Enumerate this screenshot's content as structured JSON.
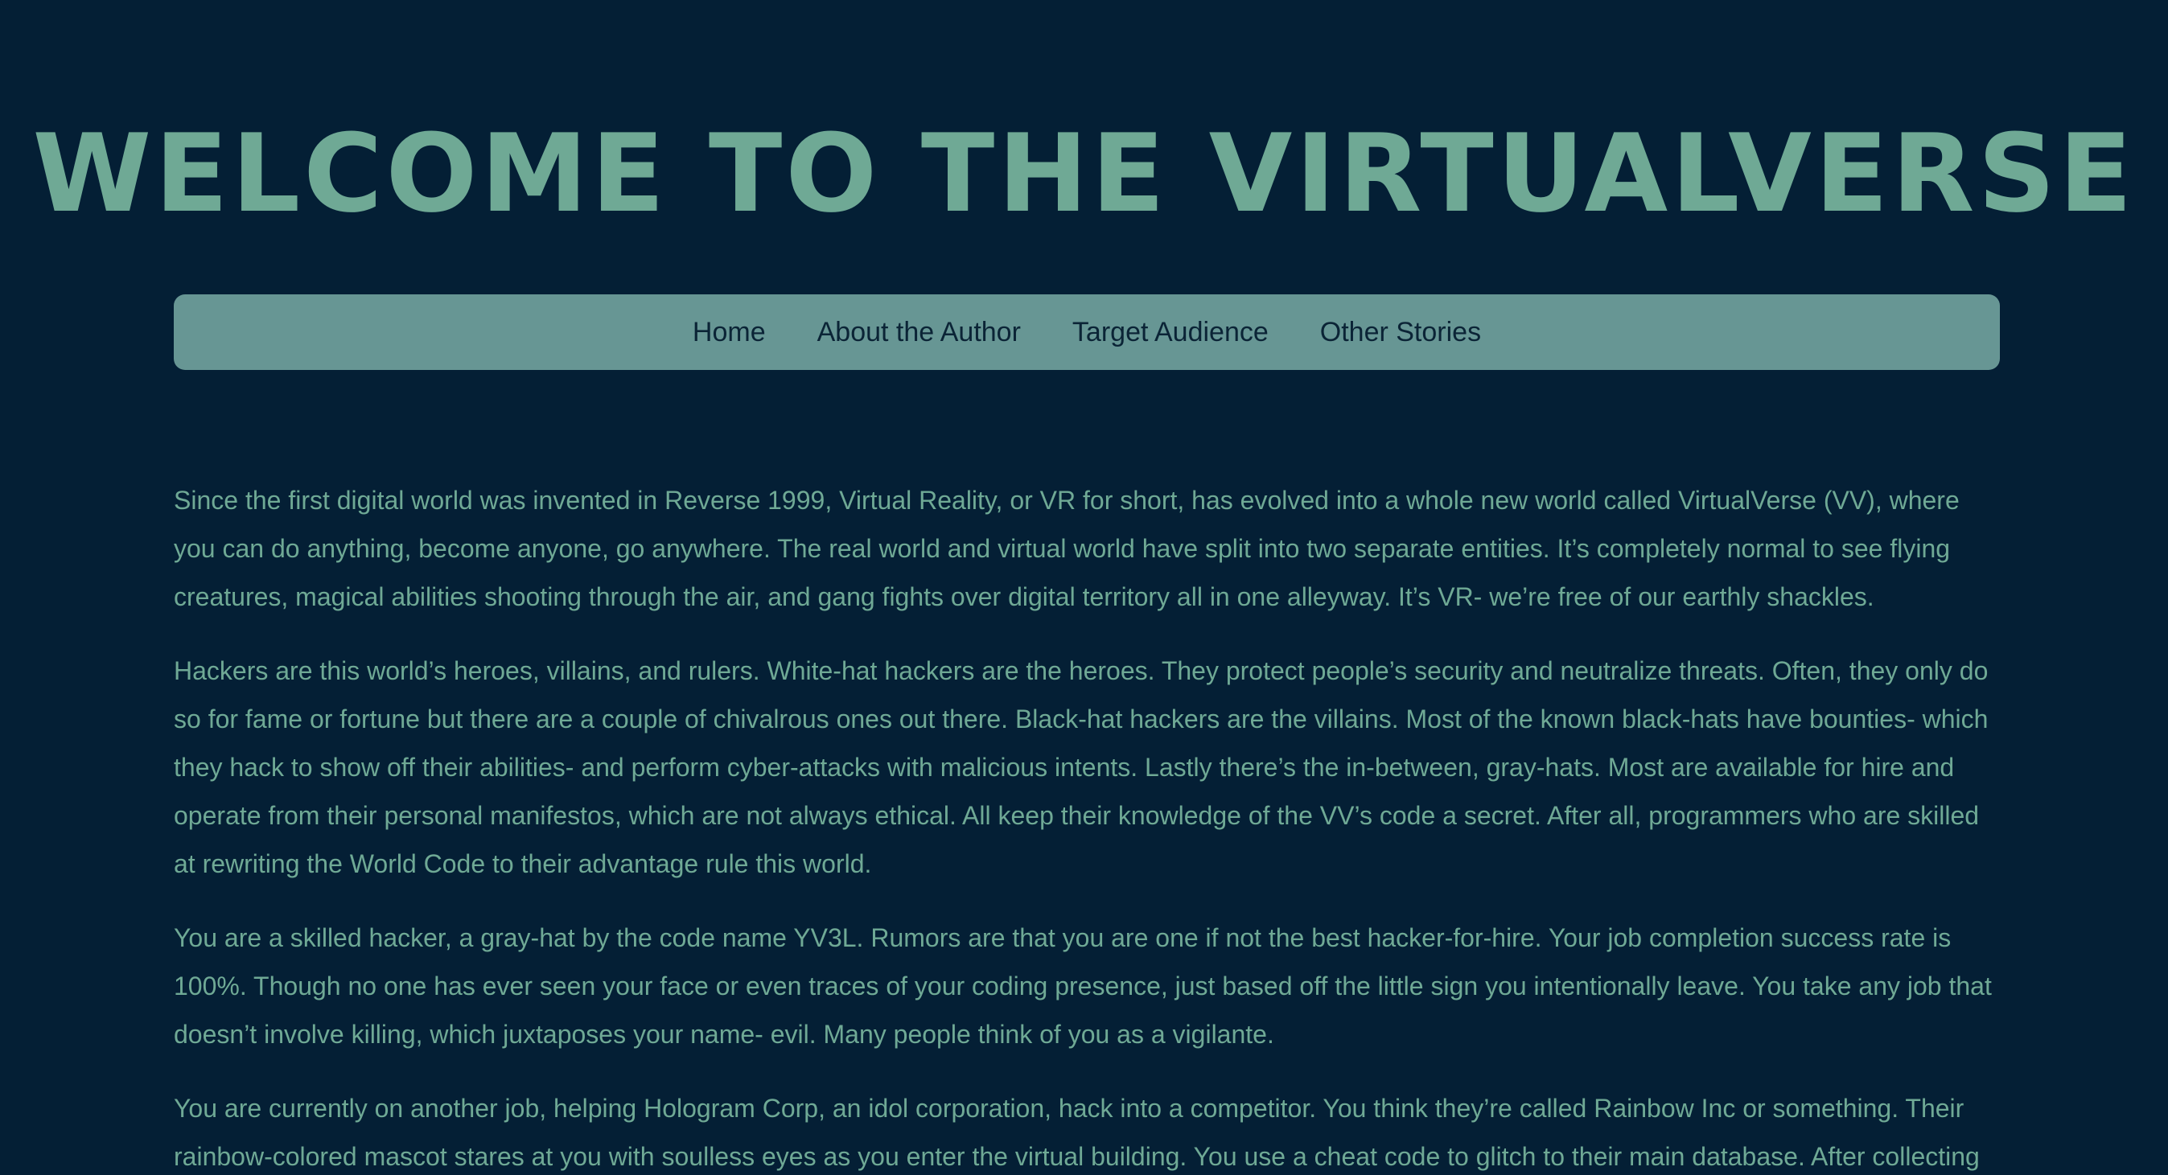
{
  "header": {
    "title": "WELCOME TO THE VIRTUALVERSE"
  },
  "nav": {
    "items": [
      {
        "label": "Home"
      },
      {
        "label": "About the Author"
      },
      {
        "label": "Target Audience"
      },
      {
        "label": "Other Stories"
      }
    ]
  },
  "story": {
    "paragraphs": [
      "Since the first digital world was invented in Reverse 1999, Virtual Reality, or VR for short, has evolved into a whole new world called VirtualVerse (VV), where you can do anything, become anyone, go anywhere. The real world and virtual world have split into two separate entities. It’s completely normal to see flying creatures, magical abilities shooting through the air, and gang fights over digital territory all in one alleyway. It’s VR- we’re free of our earthly shackles.",
      "Hackers are this world’s heroes, villains, and rulers. White-hat hackers are the heroes. They protect people’s security and neutralize threats. Often, they only do so for fame or fortune but there are a couple of chivalrous ones out there. Black-hat hackers are the villains. Most of the known black-hats have bounties- which they hack to show off their abilities- and perform cyber-attacks with malicious intents. Lastly there’s the in-between, gray-hats. Most are available for hire and operate from their personal manifestos, which are not always ethical. All keep their knowledge of the VV’s code a secret. After all, programmers who are skilled at rewriting the World Code to their advantage rule this world.",
      "You are a skilled hacker, a gray-hat by the code name YV3L. Rumors are that you are one if not the best hacker-for-hire. Your job completion success rate is 100%. Though no one has ever seen your face or even traces of your coding presence, just based off the little sign you intentionally leave. You take any job that doesn’t involve killing, which juxtaposes your name- evil. Many people think of you as a vigilante.",
      "You are currently on another job, helping Hologram Corp, an idol corporation, hack into a competitor. You think they’re called Rainbow Inc or something. Their rainbow-colored mascot stares at you with soulless eyes as you enter the virtual building. You use a cheat code to glitch to their main database. After collecting"
    ]
  }
}
